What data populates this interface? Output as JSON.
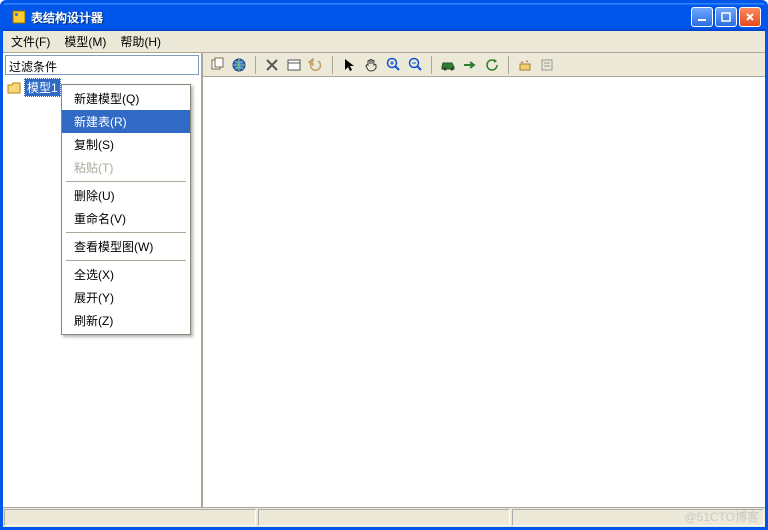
{
  "window": {
    "title": "表结构设计器"
  },
  "menubar": {
    "file": "文件(F)",
    "model": "模型(M)",
    "help": "帮助(H)"
  },
  "filter": {
    "label": "过滤条件"
  },
  "tree": {
    "root_label": "模型1"
  },
  "context_menu": {
    "new_model": "新建模型(Q)",
    "new_table": "新建表(R)",
    "copy": "复制(S)",
    "paste": "粘贴(T)",
    "delete": "删除(U)",
    "rename": "重命名(V)",
    "view_diagram": "查看模型图(W)",
    "select_all": "全选(X)",
    "expand": "展开(Y)",
    "refresh": "刷新(Z)"
  },
  "toolbar_icons": {
    "copy": "copy",
    "globe": "globe",
    "delete": "delete",
    "window": "window",
    "undo": "undo",
    "pointer": "pointer",
    "hand": "hand",
    "zoom_in": "zoom_in",
    "zoom_out": "zoom_out",
    "car": "car",
    "arrow_right": "arrow_right",
    "refresh": "refresh",
    "wizard": "wizard",
    "props": "props"
  },
  "watermark": "@51CTO博客"
}
